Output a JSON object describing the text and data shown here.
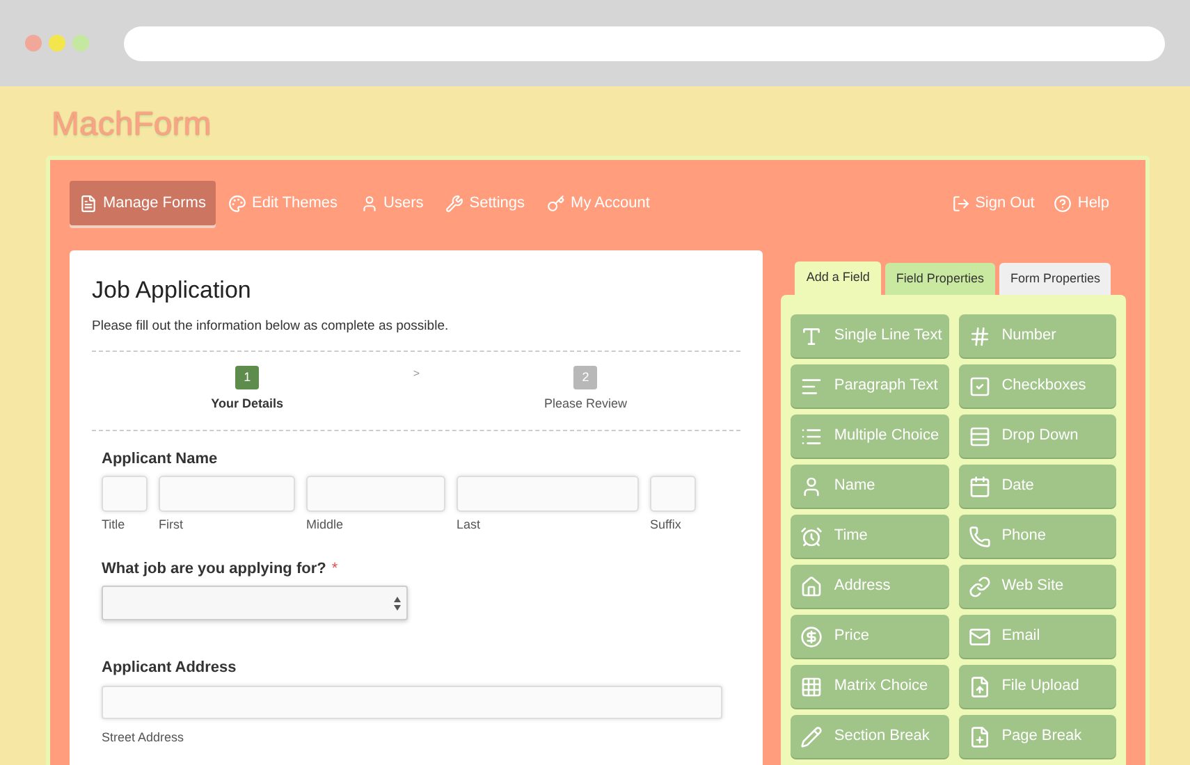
{
  "logo": "MachForm",
  "nav": {
    "left": [
      {
        "label": "Manage Forms",
        "kind": "file",
        "selected": true
      },
      {
        "label": "Edit Themes",
        "kind": "palette",
        "selected": false
      },
      {
        "label": "Users",
        "kind": "user",
        "selected": false
      },
      {
        "label": "Settings",
        "kind": "wrench",
        "selected": false
      },
      {
        "label": "My Account",
        "kind": "key",
        "selected": false
      }
    ],
    "right": [
      {
        "label": "Sign Out",
        "kind": "logout"
      },
      {
        "label": "Help",
        "kind": "help"
      }
    ]
  },
  "form": {
    "title": "Job Application",
    "description": "Please fill out the information below as complete as possible.",
    "steps": [
      {
        "number": "1",
        "label": "Your Details",
        "selected": true
      },
      {
        "number": "2",
        "label": "Please Review",
        "selected": false
      }
    ],
    "step_separator": ">",
    "fields": [
      {
        "kind": "name",
        "label": "Applicant Name",
        "parts": [
          "Title",
          "First",
          "Middle",
          "Last",
          "Suffix"
        ]
      },
      {
        "kind": "select",
        "label": "What job are you applying for?",
        "required_mark": "*"
      },
      {
        "kind": "address",
        "label": "Applicant Address",
        "sublabel": "Street Address"
      }
    ]
  },
  "side_tabs": [
    {
      "label": "Add a Field",
      "selected": true,
      "color": "#eef9b8"
    },
    {
      "label": "Field Properties",
      "selected": false,
      "color": "#c9e9a0"
    },
    {
      "label": "Form Properties",
      "selected": false,
      "color": "#efefef"
    }
  ],
  "field_types": [
    {
      "label": "Single Line Text",
      "kind": "type"
    },
    {
      "label": "Number",
      "kind": "hash"
    },
    {
      "label": "Paragraph Text",
      "kind": "paragraph"
    },
    {
      "label": "Checkboxes",
      "kind": "check"
    },
    {
      "label": "Multiple Choice",
      "kind": "list"
    },
    {
      "label": "Drop Down",
      "kind": "dropdown"
    },
    {
      "label": "Name",
      "kind": "user"
    },
    {
      "label": "Date",
      "kind": "calendar"
    },
    {
      "label": "Time",
      "kind": "clock"
    },
    {
      "label": "Phone",
      "kind": "phone"
    },
    {
      "label": "Address",
      "kind": "house"
    },
    {
      "label": "Web Site",
      "kind": "link"
    },
    {
      "label": "Price",
      "kind": "price"
    },
    {
      "label": "Email",
      "kind": "mail"
    },
    {
      "label": "Matrix Choice",
      "kind": "grid"
    },
    {
      "label": "File Upload",
      "kind": "upload"
    },
    {
      "label": "Section Break",
      "kind": "pencil"
    },
    {
      "label": "Page Break",
      "kind": "fileplus"
    }
  ]
}
